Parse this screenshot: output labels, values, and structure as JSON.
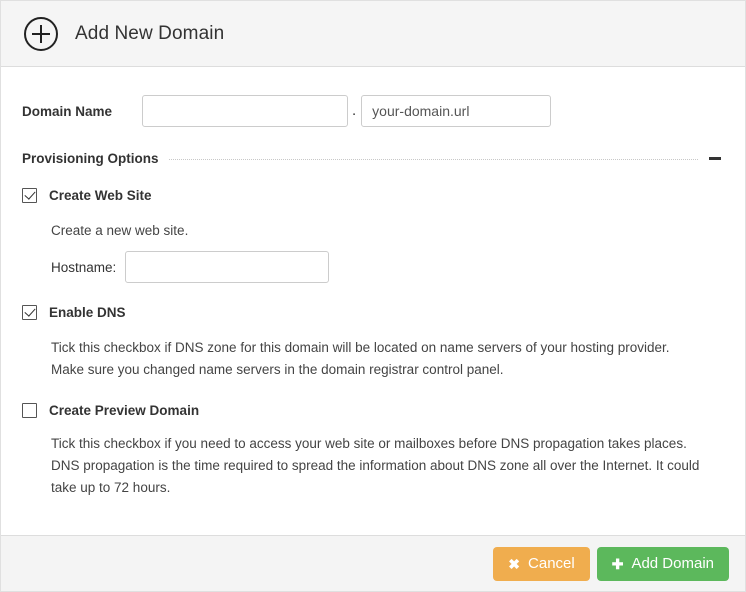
{
  "header": {
    "icon": "plus-circle-icon",
    "title": "Add New Domain"
  },
  "form": {
    "domain_name": {
      "label": "Domain Name",
      "value": "",
      "placeholder": "",
      "separator": ".",
      "suffix_value": "your-domain.url"
    },
    "section": {
      "title": "Provisioning Options",
      "collapse_icon": "minus-icon",
      "collapsed": false
    },
    "options": [
      {
        "id": "create-web-site",
        "label": "Create Web Site",
        "checked": true,
        "description": "Create a new web site.",
        "field_label": "Hostname:",
        "field_value": "",
        "field_placeholder": ""
      },
      {
        "id": "enable-dns",
        "label": "Enable DNS",
        "checked": true,
        "description": "Tick this checkbox if DNS zone for this domain will be located on name servers of your hosting provider. Make sure you changed name servers in the domain registrar control panel."
      },
      {
        "id": "create-preview-domain",
        "label": "Create Preview Domain",
        "checked": false,
        "description": "Tick this checkbox if you need to access your web site or mailboxes before DNS propagation takes places. DNS propagation is the time required to spread the information about DNS zone all over the Internet. It could take up to 72 hours."
      }
    ]
  },
  "footer": {
    "cancel_label": "Cancel",
    "cancel_glyph": "✖",
    "submit_label": "Add Domain",
    "submit_glyph": "✚"
  },
  "colors": {
    "cancel_bg": "#f0ad4e",
    "submit_bg": "#5cb85c",
    "header_bg": "#f5f5f5",
    "footer_bg": "#f4f4f4",
    "text": "#333333"
  }
}
